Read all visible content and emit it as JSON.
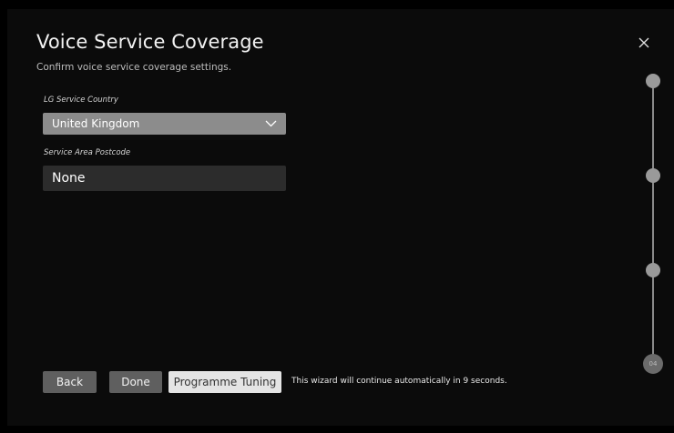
{
  "header": {
    "title": "Voice Service Coverage",
    "subtitle": "Confirm voice service coverage settings."
  },
  "form": {
    "country_label": "LG Service Country",
    "country_value": "United Kingdom",
    "postcode_label": "Service Area Postcode",
    "postcode_value": "None"
  },
  "buttons": {
    "back": "Back",
    "done": "Done",
    "programme_tuning": "Programme Tuning"
  },
  "auto_message": "This wizard will continue automatically in 9 seconds.",
  "stepper": {
    "current_step": "04",
    "total_steps": 4
  },
  "icons": {
    "close": "close-icon",
    "dropdown": "chevron-down-icon"
  },
  "colors": {
    "background": "#0b0b0b",
    "dropdown_bg": "#8c8c8c",
    "textfield_bg": "#2c2c2c",
    "button_bg": "#5f5f5f",
    "button_focused_bg": "#e4e4e4"
  }
}
